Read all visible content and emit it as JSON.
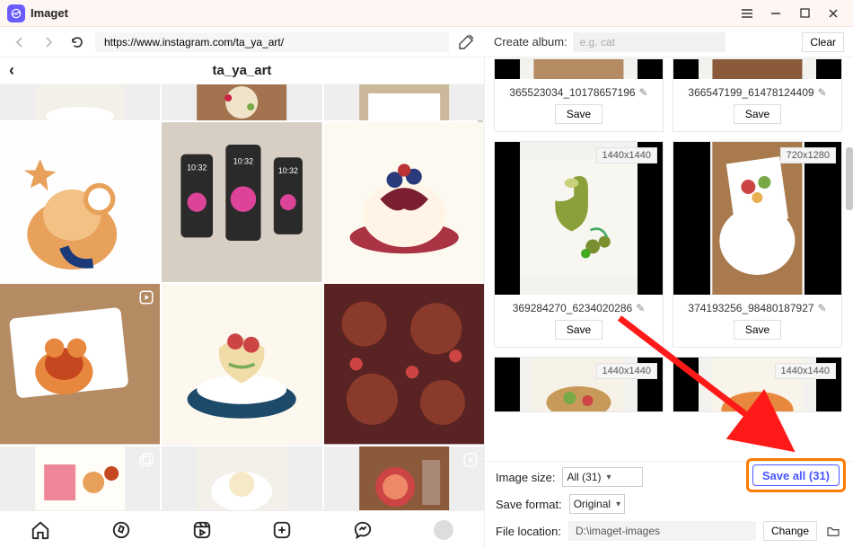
{
  "app": {
    "title": "Imaget"
  },
  "browser": {
    "url": "https://www.instagram.com/ta_ya_art/"
  },
  "profile": {
    "username": "ta_ya_art"
  },
  "album": {
    "label": "Create album:",
    "placeholder": "e.g. cat",
    "clear": "Clear"
  },
  "cards": [
    {
      "filename": "365523034_10178657196",
      "dim": "",
      "save": "Save"
    },
    {
      "filename": "366547199_61478124409",
      "dim": "",
      "save": "Save"
    },
    {
      "filename": "369284270_6234020286",
      "dim": "1440x1440",
      "save": "Save"
    },
    {
      "filename": "374193256_98480187927",
      "dim": "720x1280",
      "save": "Save"
    },
    {
      "filename": "",
      "dim": "1440x1440",
      "save": ""
    },
    {
      "filename": "",
      "dim": "1440x1440",
      "save": ""
    }
  ],
  "settings": {
    "image_size_label": "Image size:",
    "image_size_value": "All (31)",
    "save_all": "Save all (31)",
    "save_format_label": "Save format:",
    "save_format_value": "Original",
    "file_location_label": "File location:",
    "file_location_value": "D:\\imaget-images",
    "change": "Change"
  }
}
